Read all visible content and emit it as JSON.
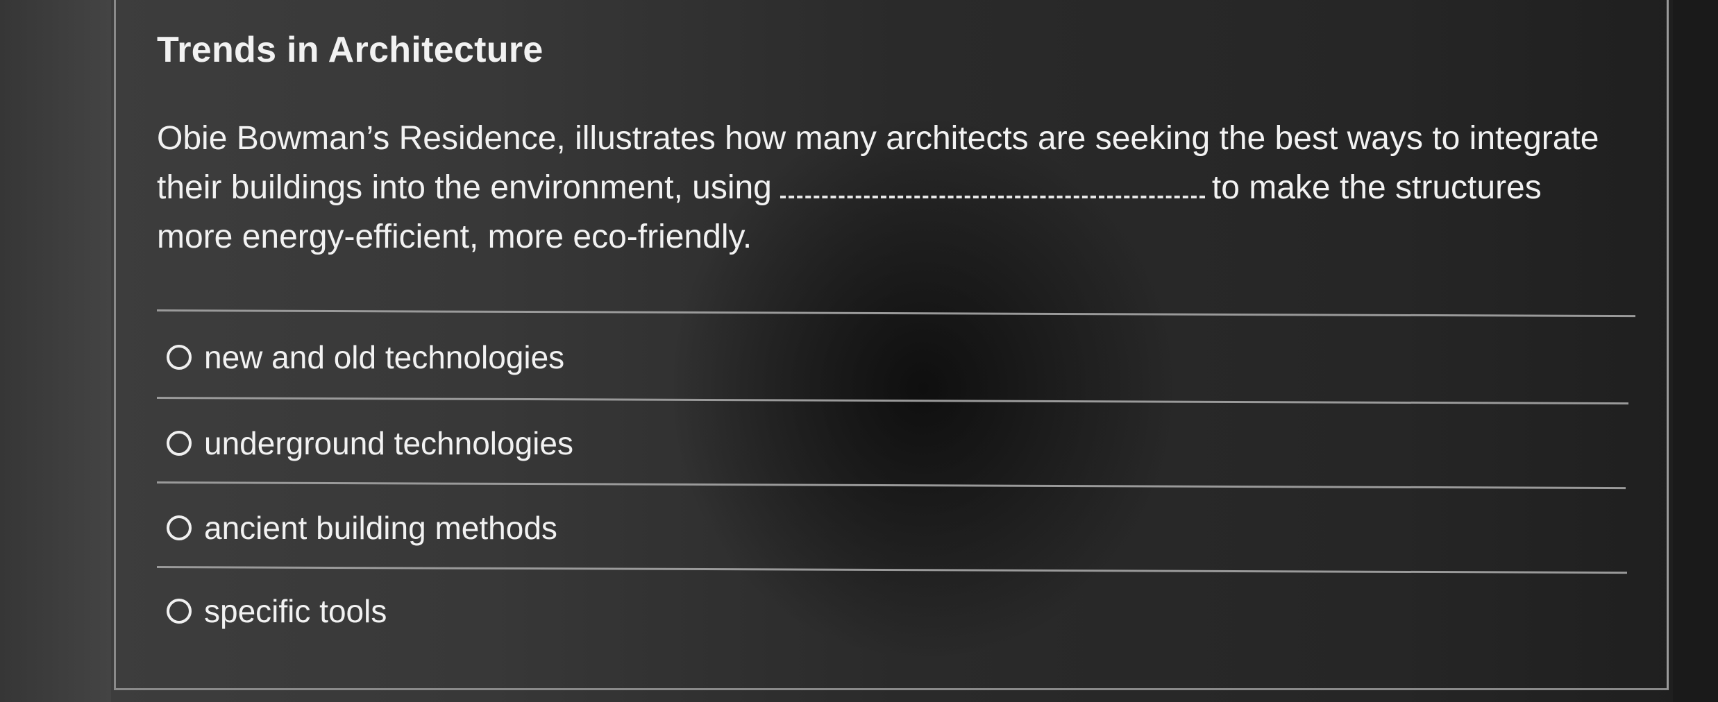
{
  "question": {
    "title": "Trends in Architecture",
    "line1": "Obie Bowman’s Residence, illustrates how many architects are seeking the best ways to integrate",
    "line2_before": "their buildings into the environment, using",
    "line2_after": "to make the structures",
    "line3": "more energy-efficient, more eco-friendly."
  },
  "options": [
    {
      "label": "new and old technologies",
      "selected": false
    },
    {
      "label": "underground technologies",
      "selected": false
    },
    {
      "label": "ancient building methods",
      "selected": false
    },
    {
      "label": "specific tools",
      "selected": false
    }
  ]
}
